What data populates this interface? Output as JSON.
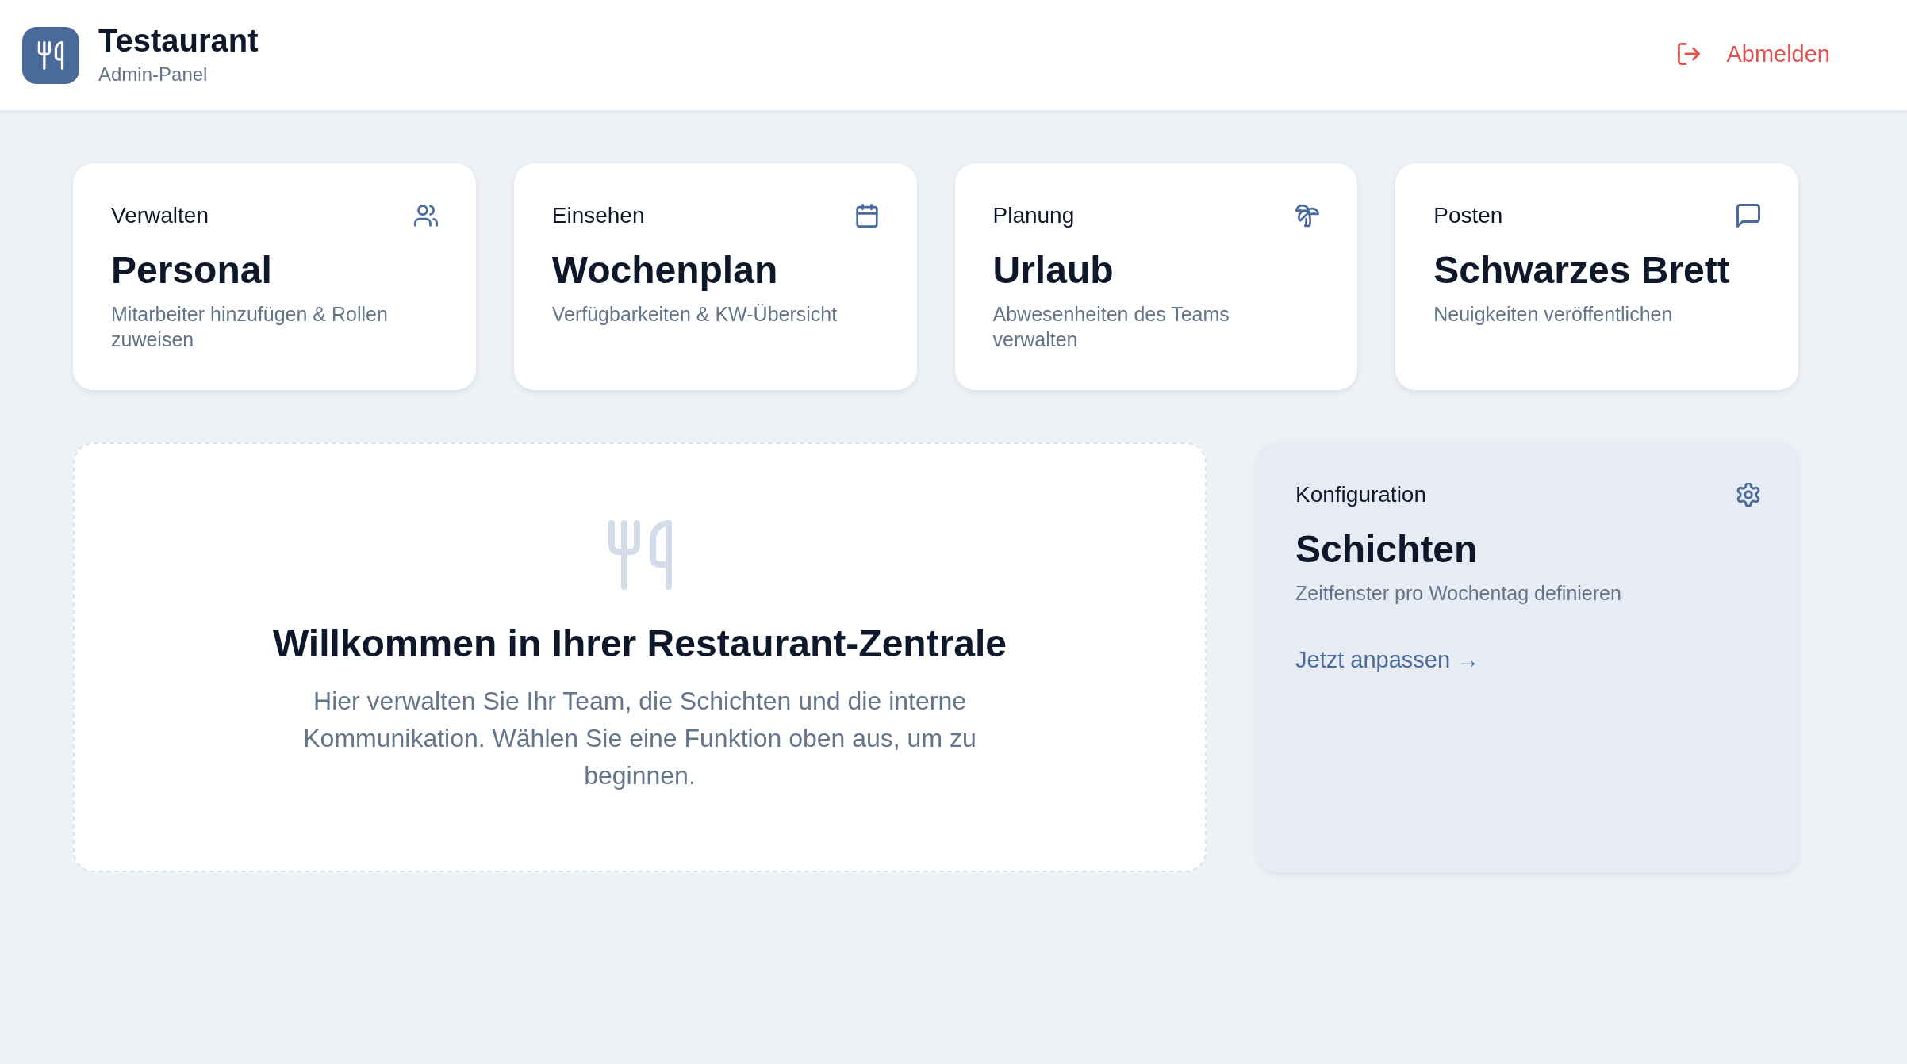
{
  "header": {
    "app_name": "Testaurant",
    "subtitle": "Admin-Panel",
    "logout_label": "Abmelden"
  },
  "feature_cards": [
    {
      "label": "Verwalten",
      "title": "Personal",
      "description": "Mitarbeiter hinzufügen & Rollen zuweisen"
    },
    {
      "label": "Einsehen",
      "title": "Wochenplan",
      "description": "Verfügbarkeiten & KW-Übersicht"
    },
    {
      "label": "Planung",
      "title": "Urlaub",
      "description": "Abwesenheiten des Teams verwalten"
    },
    {
      "label": "Posten",
      "title": "Schwarzes Brett",
      "description": "Neuigkeiten veröffentlichen"
    }
  ],
  "welcome": {
    "title": "Willkommen in Ihrer Restaurant-Zentrale",
    "text": "Hier verwalten Sie Ihr Team, die Schichten und die interne Kommunikation. Wählen Sie eine Funktion oben aus, um zu beginnen."
  },
  "config_card": {
    "label": "Konfiguration",
    "title": "Schichten",
    "description": "Zeitfenster pro Wochentag definieren",
    "link": "Jetzt anpassen →"
  }
}
